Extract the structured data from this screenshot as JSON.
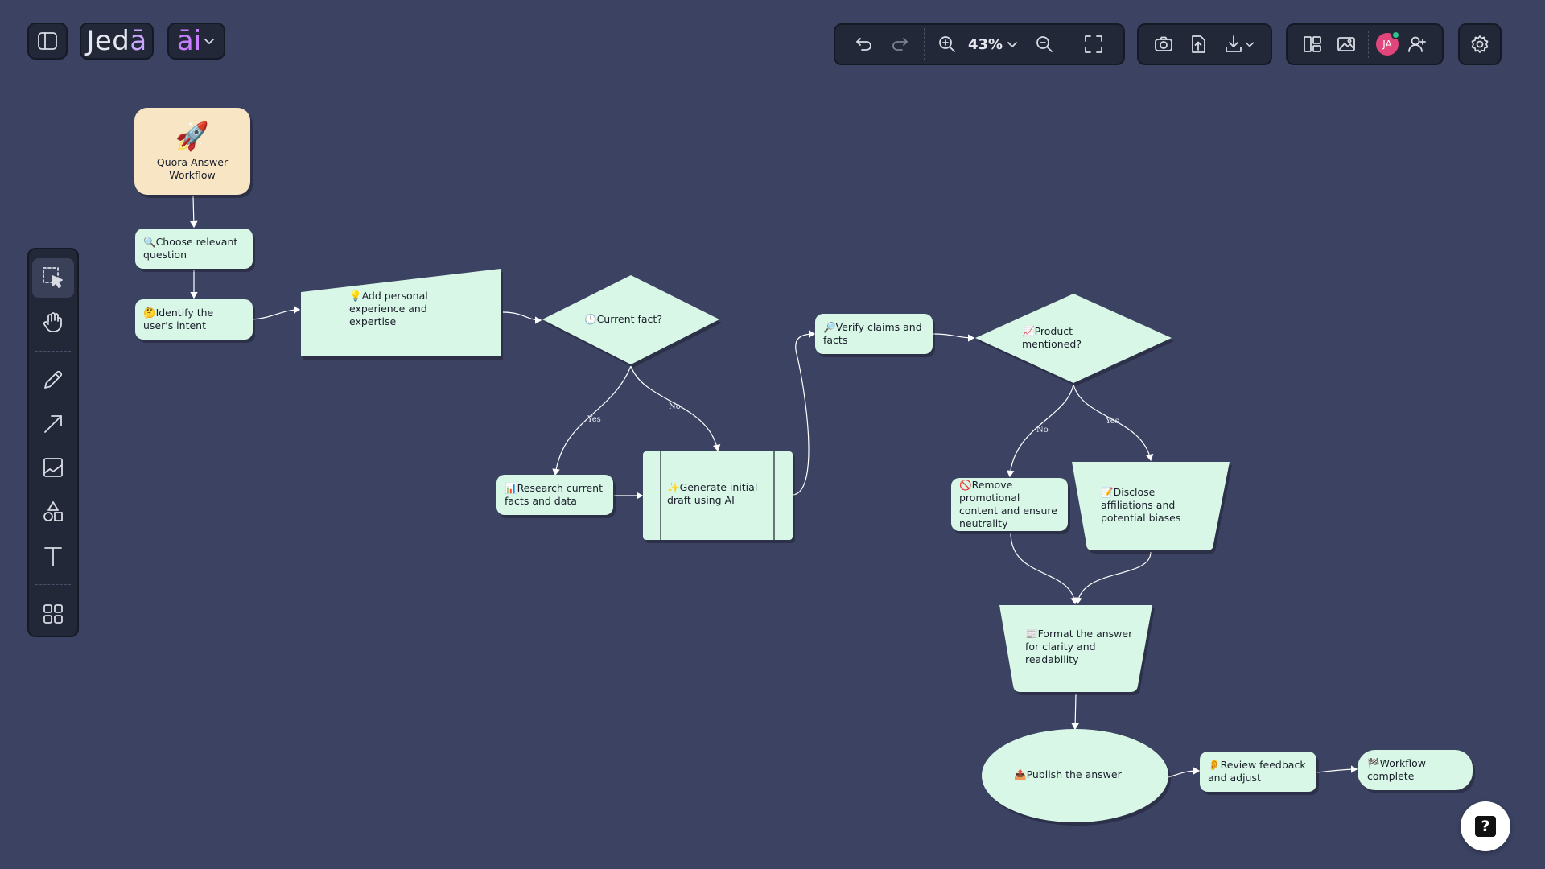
{
  "app": {
    "brand_main": "Jed",
    "brand_accent": "ā",
    "ai_label": "āi"
  },
  "toolbar": {
    "zoom_level": "43%",
    "avatar_initials": "JA"
  },
  "colors": {
    "background": "#3b4262",
    "node_fill": "#d8f7e6",
    "start_fill": "#f7e5c4",
    "edge": "#ffffff",
    "avatar": "#e0457b",
    "presence": "#2fc38c"
  },
  "icons": {
    "sidebar_toggle": "sidebar-icon",
    "undo": "undo-icon",
    "redo": "redo-icon",
    "zoom_in": "zoom-in-icon",
    "zoom_out": "zoom-out-icon",
    "fullscreen": "fullscreen-icon",
    "screenshot": "camera-icon",
    "upload": "upload-icon",
    "download": "download-icon",
    "layout": "layout-icon",
    "image_ai": "image-ai-icon",
    "add_user": "add-user-icon",
    "settings": "gear-icon",
    "select": "select-icon",
    "hand": "hand-icon",
    "pencil": "pencil-icon",
    "arrow": "arrow-icon",
    "image": "image-icon",
    "shapes": "shapes-icon",
    "text": "text-icon",
    "components": "grid-icon",
    "help": "help-icon"
  },
  "flowchart": {
    "start": {
      "emoji": "🚀",
      "label": "Quora Answer Workflow"
    },
    "nodes": {
      "choose_question": "🔍Choose relevant question",
      "identify_intent": "🤔Identify the user's intent",
      "add_experience": "💡Add personal experience and expertise",
      "current_fact": "🕒Current fact?",
      "research_facts": "📊Research current facts and data",
      "generate_draft": "✨Generate initial draft using AI",
      "verify_claims": "🔎Verify claims and facts",
      "product_mentioned": "📈Product mentioned?",
      "remove_promo": "🚫Remove promotional content and ensure neutrality",
      "disclose": "📝Disclose affiliations and potential biases",
      "format_answer": "📰Format the answer for clarity and readability",
      "publish": "📤Publish the answer",
      "review_feedback": "👂Review feedback and adjust",
      "complete": "🏁Workflow complete"
    },
    "edge_labels": {
      "fact_yes": "Yes",
      "fact_no": "No",
      "product_no": "No",
      "product_yes": "Yes"
    }
  }
}
